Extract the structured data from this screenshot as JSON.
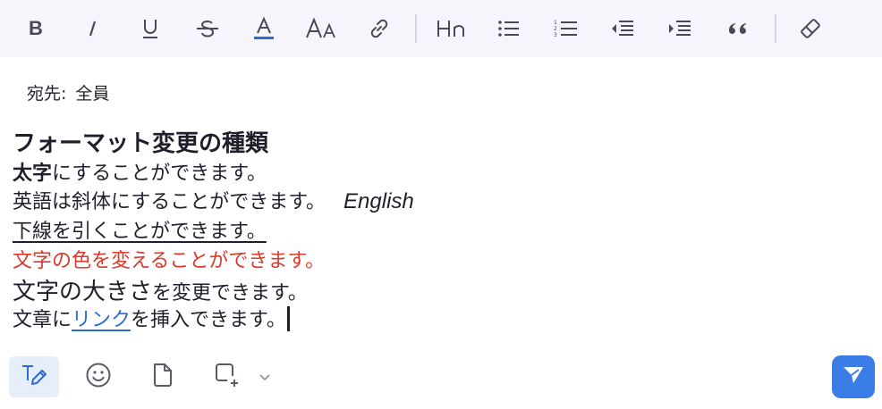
{
  "toolbar": {
    "buttons": [
      {
        "icon": "bold-icon"
      },
      {
        "icon": "italic-icon"
      },
      {
        "icon": "underline-icon"
      },
      {
        "icon": "strikethrough-icon"
      },
      {
        "icon": "text-color-icon"
      },
      {
        "icon": "font-size-icon"
      },
      {
        "icon": "link-icon"
      },
      {
        "icon": "heading-icon"
      },
      {
        "icon": "bulleted-list-icon"
      },
      {
        "icon": "numbered-list-icon"
      },
      {
        "icon": "outdent-icon"
      },
      {
        "icon": "indent-icon"
      },
      {
        "icon": "quote-icon"
      },
      {
        "icon": "clear-format-icon"
      }
    ],
    "text_color_accent": "#2d6ad6"
  },
  "recipient": {
    "label": "宛先:",
    "value": "全員"
  },
  "message": {
    "title": "フォーマット変更の種類",
    "line1_bold": "太字",
    "line1_rest": "にすることができます。",
    "line2_text": "英語は斜体にすることができます。",
    "line2_italic": "English",
    "line3": "下線を引くことができます。",
    "line4": "文字の色を変えることができます。",
    "line4_color": "#d93a2b",
    "line5_big": "文字の大きさ",
    "line5_rest": "を変更できます。",
    "line6_pre": "文章に",
    "line6_link": "リンク",
    "line6_post": "を挿入できます。"
  },
  "bottom_bar": {
    "buttons": [
      {
        "icon": "format-text-icon",
        "active": true
      },
      {
        "icon": "emoji-icon"
      },
      {
        "icon": "file-icon"
      },
      {
        "icon": "new-frame-icon"
      },
      {
        "icon": "chevron-down-icon"
      }
    ],
    "send_icon": "send-icon",
    "send_color": "#3b7de6"
  }
}
